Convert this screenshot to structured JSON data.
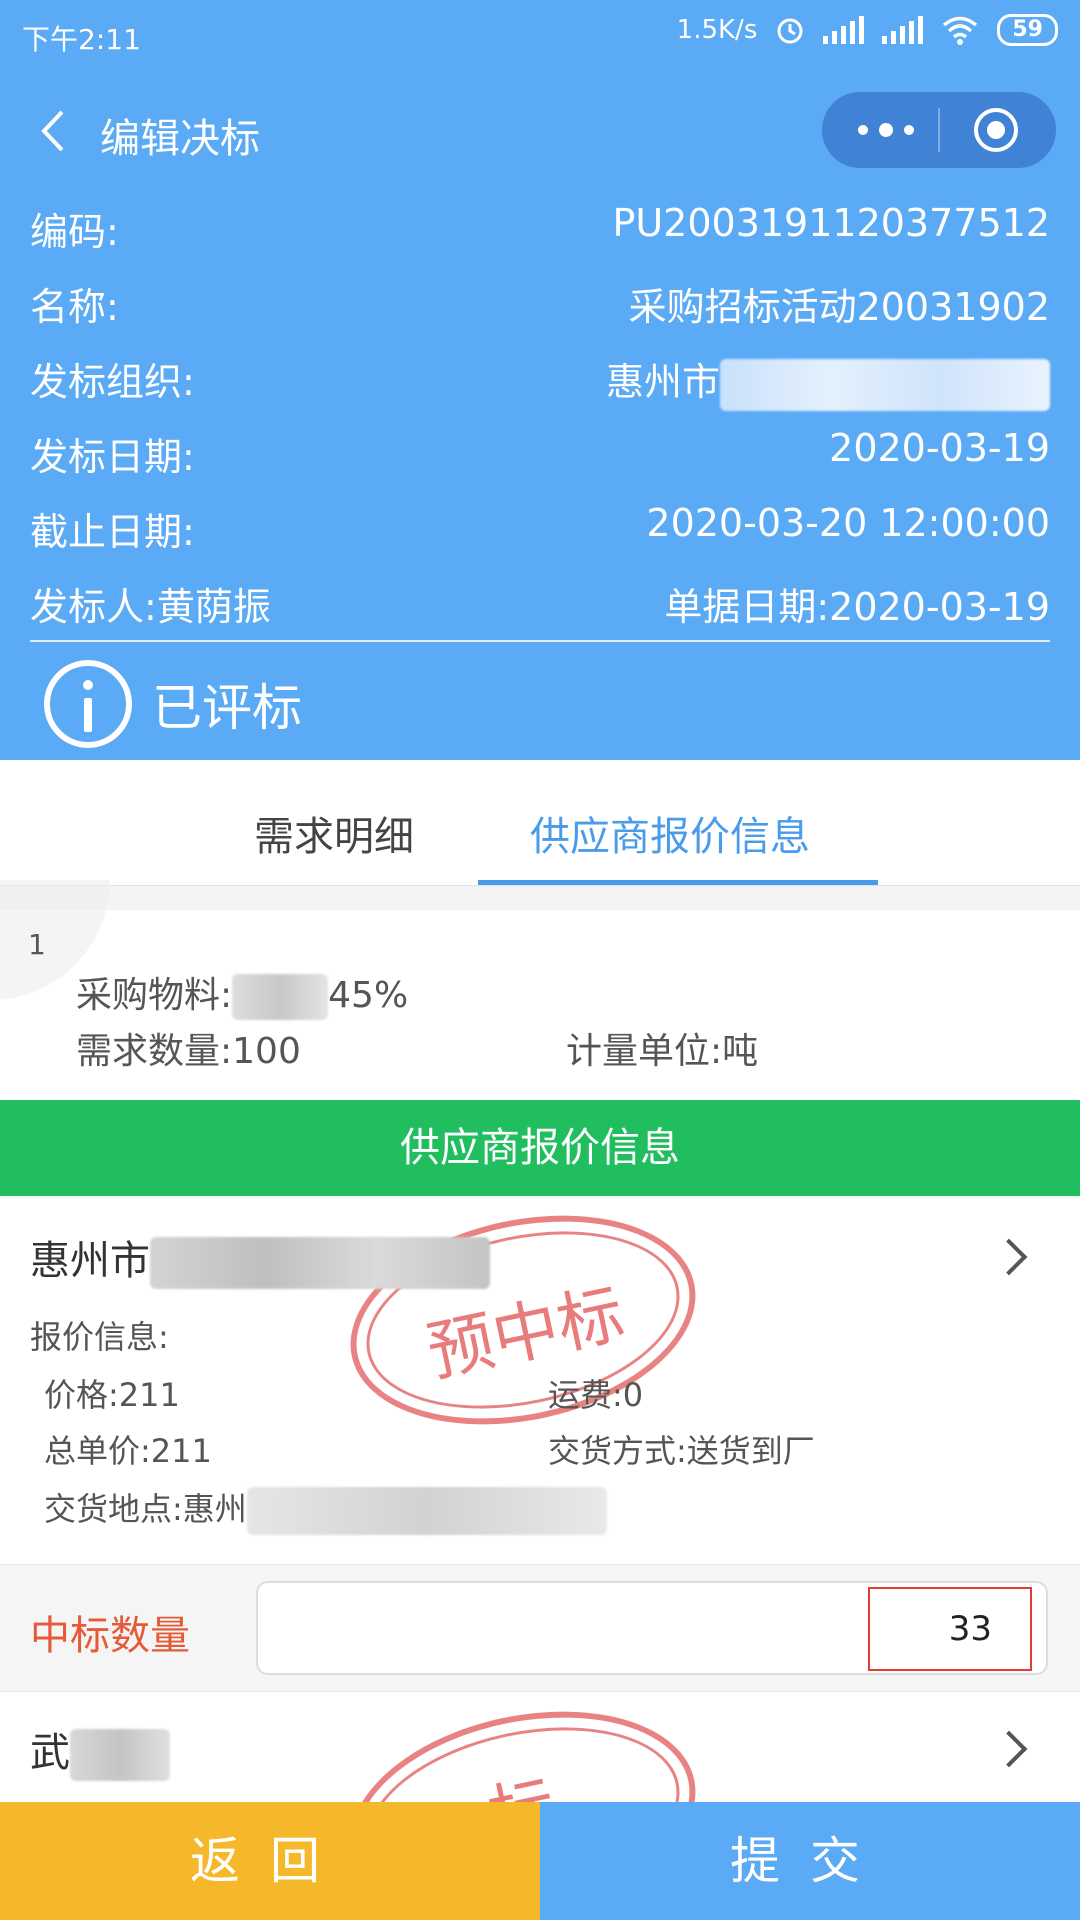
{
  "status_bar": {
    "time": "下午2:11",
    "speed": "1.5K/s",
    "battery": "59",
    "icons": [
      "alarm-icon",
      "signal-icon",
      "signal-icon",
      "wifi-icon",
      "battery-icon"
    ]
  },
  "nav": {
    "title": "编辑决标",
    "back_icon": "chevron-left-icon",
    "more_icon": "more-dots-icon",
    "close_icon": "target-icon"
  },
  "info": {
    "code_label": "编码:",
    "code_value": "PU2003191120377512",
    "name_label": "名称:",
    "name_value": "采购招标活动20031902",
    "org_label": "发标组织:",
    "org_value": "惠州市",
    "issue_date_label": "发标日期:",
    "issue_date_value": "2020-03-19",
    "deadline_label": "截止日期:",
    "deadline_value": "2020-03-20 12:00:00",
    "issuer_label": "发标人:",
    "issuer_value": "黄荫振",
    "doc_date_label": "单据日期:",
    "doc_date_value": "2020-03-19",
    "status_text": "已评标"
  },
  "tabs": [
    {
      "label": "需求明细",
      "active": false
    },
    {
      "label": "供应商报价信息",
      "active": true
    }
  ],
  "demand": {
    "index": "1",
    "material_label": "采购物料:",
    "material_suffix": "45%",
    "qty_label": "需求数量:",
    "qty_value": "100",
    "unit_label": "计量单位:",
    "unit_value": "吨"
  },
  "banner": "供应商报价信息",
  "supplier1": {
    "name_prefix": "惠州市",
    "quote_label": "报价信息:",
    "price_label": "价格:",
    "price_value": "211",
    "freight_label": "运费:",
    "freight_value": "0",
    "unit_price_label": "总单价:",
    "unit_price_value": "211",
    "delivery_label": "交货方式:",
    "delivery_value": "送货到厂",
    "location_label": "交货地点:",
    "location_prefix": "惠州",
    "stamp_text": "预中标"
  },
  "award": {
    "label": "中标数量",
    "value": "33"
  },
  "supplier2": {
    "name_prefix": "武",
    "stamp_text": "标"
  },
  "buttons": {
    "back": "返回",
    "submit": "提交"
  },
  "colors": {
    "header_blue": "#5aaaf5",
    "green": "#21be5f",
    "orange": "#f6b82b",
    "accent_red": "#e65a3a"
  }
}
